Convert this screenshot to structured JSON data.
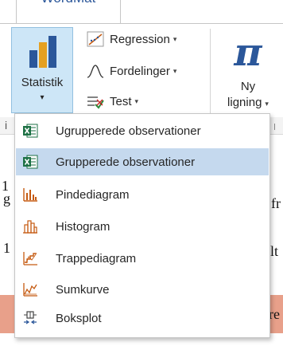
{
  "ribbon": {
    "tab_label": "WordMat",
    "statistik": {
      "label": "Statistik",
      "arrow": "▾"
    },
    "regression": {
      "label": "Regression",
      "arrow": "▾"
    },
    "fordelinger": {
      "label": "Fordelinger",
      "arrow": "▾"
    },
    "test": {
      "label": "Test",
      "arrow": "▾"
    },
    "ny_ligning": {
      "symbol": "π",
      "line1": "Ny",
      "line2": "ligning",
      "arrow": "▾"
    }
  },
  "document": {
    "ruler_mark": "i",
    "fragments": [
      "1",
      "g",
      "fr",
      "1",
      "lt",
      "re"
    ]
  },
  "menu": {
    "items": [
      {
        "label": "Ugrupperede observationer",
        "icon": "excel-icon",
        "highlighted": false
      },
      {
        "label": "Grupperede observationer",
        "icon": "excel-icon",
        "highlighted": true
      },
      {
        "label": "Pindediagram",
        "icon": "bar-chart-icon",
        "highlighted": false
      },
      {
        "label": "Histogram",
        "icon": "histogram-icon",
        "highlighted": false
      },
      {
        "label": "Trappediagram",
        "icon": "step-chart-icon",
        "highlighted": false
      },
      {
        "label": "Sumkurve",
        "icon": "cumulative-curve-icon",
        "highlighted": false
      },
      {
        "label": "Boksplot",
        "icon": "boxplot-icon",
        "highlighted": false
      }
    ]
  },
  "colors": {
    "accent": "#2b579a",
    "highlight": "#c5d9ee",
    "button_active": "#cde6f7",
    "excel_green": "#1e7145",
    "chart_orange": "#c55a11"
  }
}
